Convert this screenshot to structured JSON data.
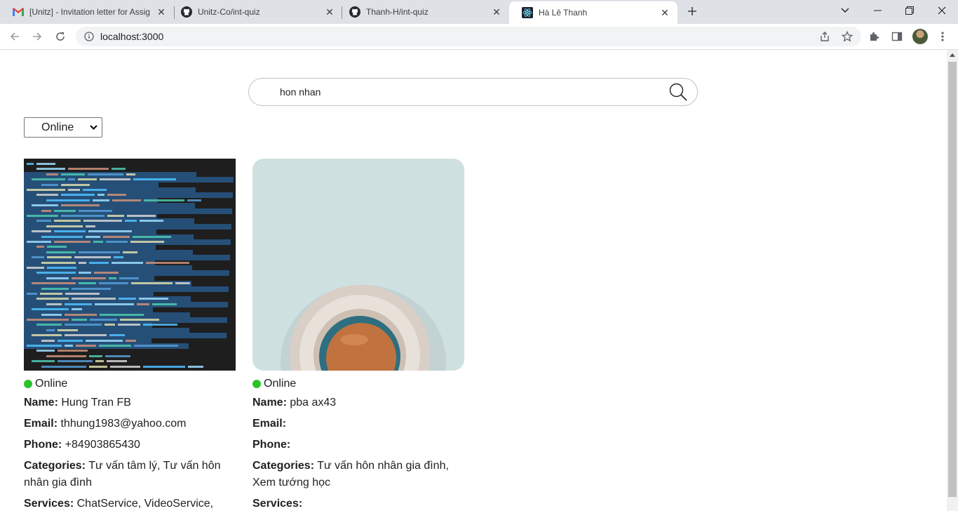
{
  "browser": {
    "tabs": [
      {
        "title": "[Unitz] - Invitation letter for Assig",
        "icon": "gmail-icon"
      },
      {
        "title": "Unitz-Co/int-quiz",
        "icon": "github-icon"
      },
      {
        "title": "Thanh-H/int-quiz",
        "icon": "github-icon"
      },
      {
        "title": "Hà Lê Thanh",
        "icon": "react-icon",
        "active": true
      }
    ],
    "url": "localhost:3000"
  },
  "search": {
    "value": "hon nhan"
  },
  "filter": {
    "selected": "Online"
  },
  "cards": [
    {
      "image": "code-screenshot",
      "status": "Online",
      "name_label": "Name:",
      "name": "Hung Tran FB",
      "email_label": "Email:",
      "email": "thhung1983@yahoo.com",
      "phone_label": "Phone:",
      "phone": "+84903865430",
      "categories_label": "Categories:",
      "categories": "Tư vấn tâm lý, Tư vấn hôn nhân gia đình",
      "services_label": "Services:",
      "services": "ChatService, VideoService,"
    },
    {
      "image": "coffee-cup",
      "status": "Online",
      "name_label": "Name:",
      "name": "pba ax43",
      "email_label": "Email:",
      "email": "",
      "phone_label": "Phone:",
      "phone": "",
      "categories_label": "Categories:",
      "categories": "Tư vấn hôn nhân gia đình, Xem tướng học",
      "services_label": "Services:",
      "services": ""
    }
  ],
  "colors": {
    "status_online": "#2ac42a",
    "tabstrip": "#dee1e6"
  }
}
